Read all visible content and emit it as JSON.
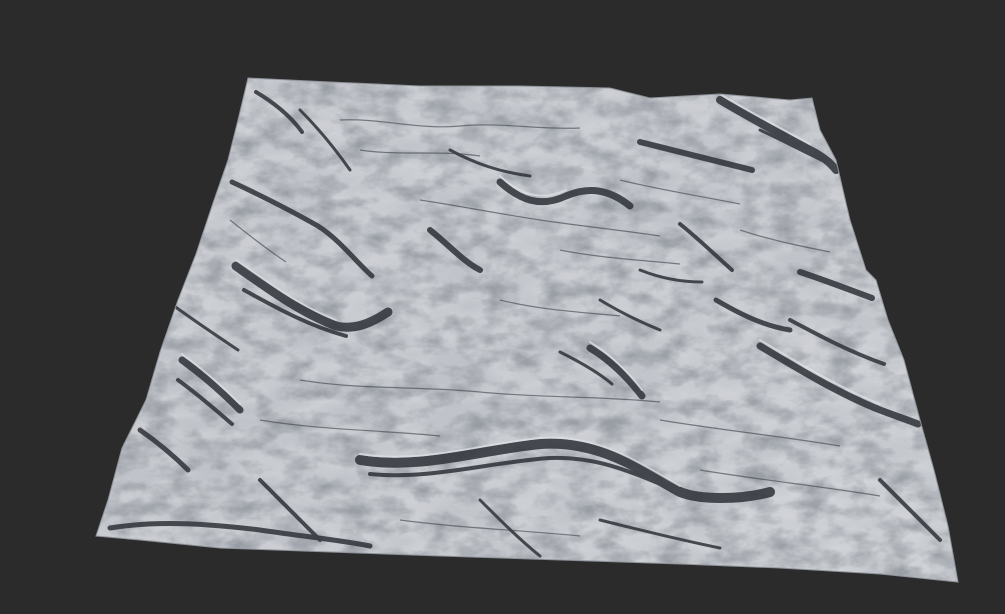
{
  "scene": {
    "subject": "terrain-heightmap",
    "colors": {
      "viewport_background": "#2b2b2b",
      "terrain_base": "#b8bcc3",
      "terrain_light": "#d2d5da",
      "terrain_shadow": "#2f3339",
      "terrain_mid": "#9ba0a8"
    }
  }
}
